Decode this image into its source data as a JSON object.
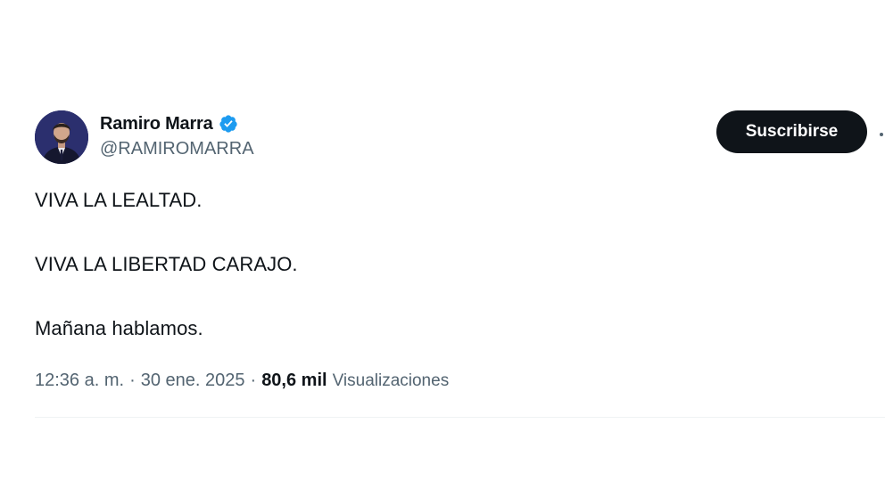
{
  "author": {
    "name": "Ramiro Marra",
    "handle": "@RAMIROMARRA",
    "verified": true,
    "verified_color": "#1d9bf0"
  },
  "actions": {
    "subscribe_label": "Suscribirse",
    "more_icon": "more-dots-icon"
  },
  "tweet": {
    "lines": [
      "VIVA LA LEALTAD.",
      "VIVA LA LIBERTAD CARAJO.",
      "Mañana hablamos."
    ]
  },
  "meta": {
    "time": "12:36 a. m.",
    "separator": "·",
    "date": "30 ene. 2025",
    "views_count": "80,6 mil",
    "views_label": "Visualizaciones"
  },
  "colors": {
    "text_primary": "#0f1419",
    "text_secondary": "#536471",
    "button_bg": "#0f1419",
    "divider": "#eff3f4"
  }
}
